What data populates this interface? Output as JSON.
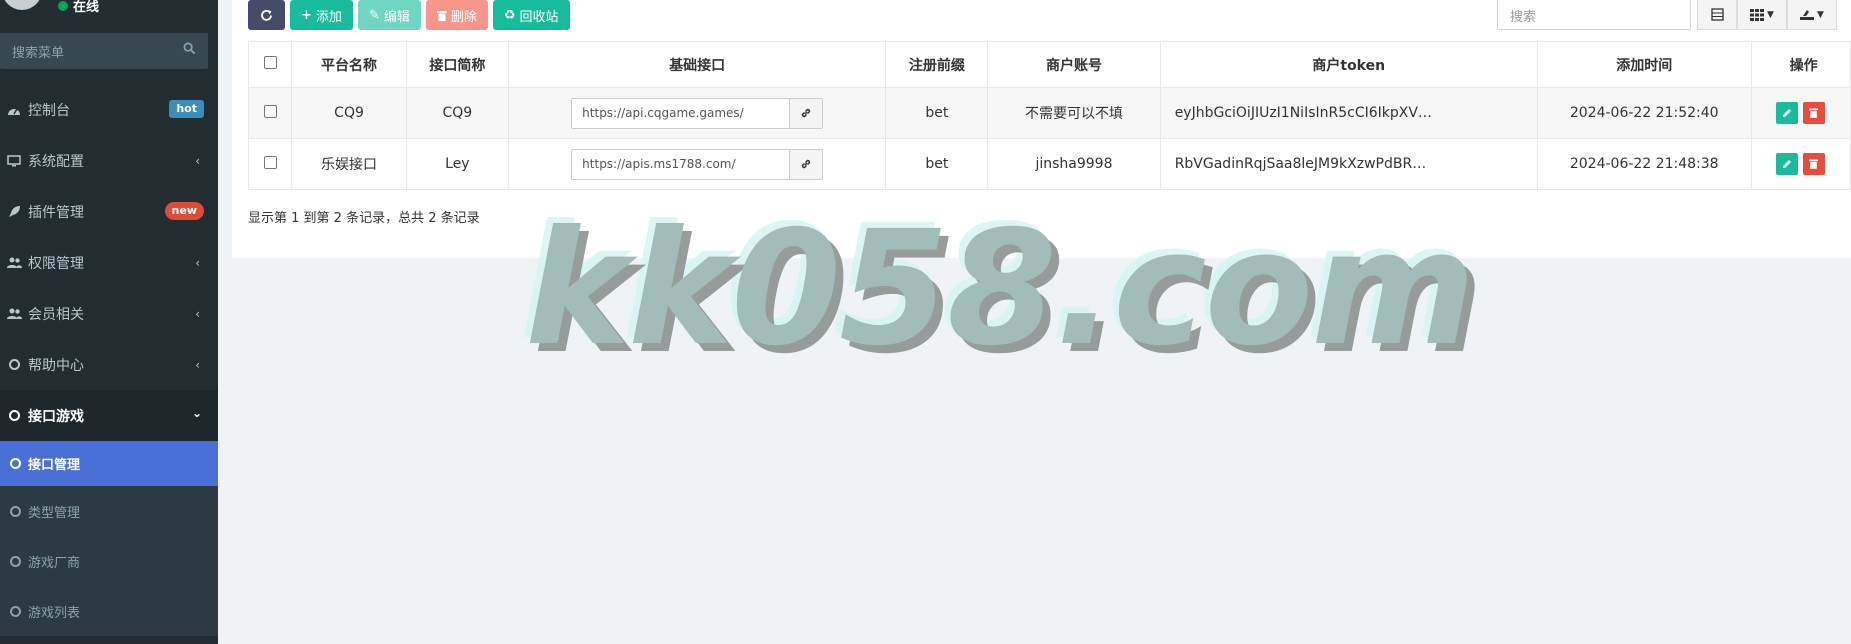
{
  "sidebar": {
    "status": "在线",
    "search_placeholder": "搜索菜单",
    "menu": [
      {
        "label": "控制台",
        "badge": "hot"
      },
      {
        "label": "系统配置"
      },
      {
        "label": "插件管理",
        "badge": "new"
      },
      {
        "label": "权限管理"
      },
      {
        "label": "会员相关"
      },
      {
        "label": "帮助中心"
      },
      {
        "label": "接口游戏"
      }
    ],
    "submenu": [
      {
        "label": "接口管理"
      },
      {
        "label": "类型管理"
      },
      {
        "label": "游戏厂商"
      },
      {
        "label": "游戏列表"
      }
    ]
  },
  "toolbar": {
    "add": "添加",
    "edit": "编辑",
    "delete": "删除",
    "recycle": "回收站",
    "search_placeholder": "搜索"
  },
  "table": {
    "headers": [
      "平台名称",
      "接口简称",
      "基础接口",
      "注册前缀",
      "商户账号",
      "商户token",
      "添加时间",
      "操作"
    ],
    "rows": [
      {
        "name": "CQ9",
        "short": "CQ9",
        "url": "https://api.cqgame.games/",
        "prefix": "bet",
        "account": "不需要可以不填",
        "token": "eyJhbGciOiJIUzI1NiIsInR5cCI6IkpXV…",
        "time": "2024-06-22 21:52:40"
      },
      {
        "name": "乐娱接口",
        "short": "Ley",
        "url": "https://apis.ms1788.com/",
        "prefix": "bet",
        "account": "jinsha9998",
        "token": "RbVGadinRqjSaa8leJM9kXzwPdBR…",
        "time": "2024-06-22 21:48:38"
      }
    ]
  },
  "pagination": {
    "info": "显示第 1 到第 2 条记录，总共 2 条记录"
  },
  "watermark": "kk058.com",
  "colors": {
    "sidebar": "#222d32",
    "accent": "#18bc9c",
    "active": "#4a6fd7",
    "danger": "#e74c3c"
  }
}
